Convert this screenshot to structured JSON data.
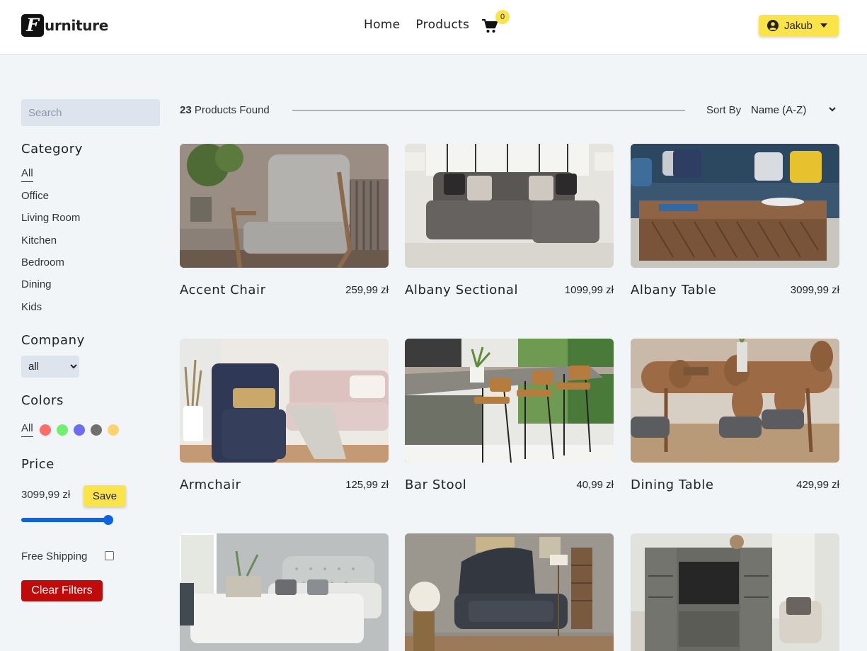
{
  "brand": {
    "logo_letter": "F",
    "logo_text": "urniture"
  },
  "nav": {
    "home": "Home",
    "products": "Products",
    "cart_count": "0"
  },
  "user": {
    "name": "Jakub",
    "icon": "user-circle-icon"
  },
  "filters": {
    "search_placeholder": "Search",
    "category_title": "Category",
    "categories": [
      "All",
      "Office",
      "Living Room",
      "Kitchen",
      "Bedroom",
      "Dining",
      "Kids"
    ],
    "active_category": "All",
    "company_title": "Company",
    "company_value": "all",
    "colors_title": "Colors",
    "colors_all": "All",
    "colors": [
      "#ff6b6b",
      "#6ff06f",
      "#6d6cf2",
      "#707070",
      "#fdd36e"
    ],
    "price_title": "Price",
    "price_value": "3099,99 zł",
    "price_fraction": 1.0,
    "save_label": "Save",
    "free_shipping_label": "Free Shipping",
    "free_shipping_checked": false,
    "clear_label": "Clear Filters"
  },
  "products_header": {
    "count": "23",
    "count_suffix": "Products Found",
    "sort_label": "Sort By",
    "sort_value": "Name (A-Z)"
  },
  "products": [
    {
      "name": "Accent Chair",
      "price": "259,99 zł"
    },
    {
      "name": "Albany Sectional",
      "price": "1099,99 zł"
    },
    {
      "name": "Albany Table",
      "price": "3099,99 zł"
    },
    {
      "name": "Armchair",
      "price": "125,99 zł"
    },
    {
      "name": "Bar Stool",
      "price": "40,99 zł"
    },
    {
      "name": "Dining Table",
      "price": "429,99 zł"
    },
    {
      "name": "",
      "price": ""
    },
    {
      "name": "",
      "price": ""
    },
    {
      "name": "",
      "price": ""
    }
  ],
  "colors": {
    "accent": "#fbe44a",
    "danger": "#c00b0b",
    "slider": "#0b63e5",
    "background": "#f1f5f8"
  }
}
